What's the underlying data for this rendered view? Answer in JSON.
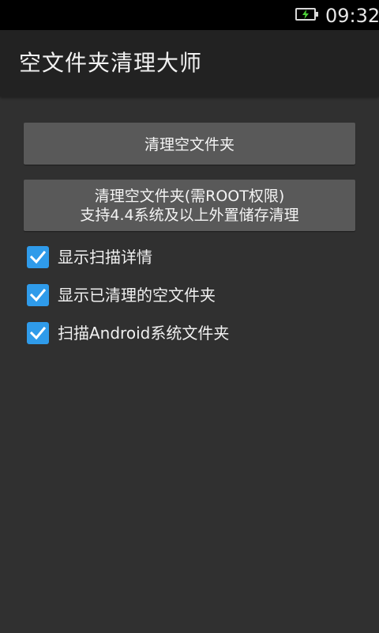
{
  "status_bar": {
    "time": "09:32",
    "battery_icon": "battery-charging-icon",
    "accent": "#2f9bea"
  },
  "app": {
    "title": "空文件夹清理大师"
  },
  "buttons": {
    "clean_label": "清理空文件夹",
    "root_line1": "清理空文件夹(需ROOT权限)",
    "root_line2": "支持4.4系统及以上外置储存清理"
  },
  "options": [
    {
      "label": "显示扫描详情",
      "checked": true
    },
    {
      "label": "显示已清理的空文件夹",
      "checked": true
    },
    {
      "label": "扫描Android系统文件夹",
      "checked": true
    }
  ]
}
